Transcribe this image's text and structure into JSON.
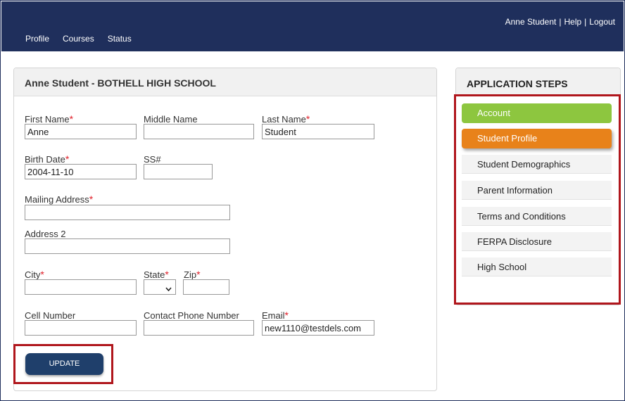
{
  "header": {
    "user_name": "Anne Student",
    "help": "Help",
    "logout": "Logout",
    "separator": "|"
  },
  "nav": {
    "items": [
      {
        "label": "Profile"
      },
      {
        "label": "Courses"
      },
      {
        "label": "Status"
      }
    ]
  },
  "form": {
    "title": "Anne Student - BOTHELL HIGH SCHOOL",
    "required_mark": "*",
    "first_name": {
      "label": "First Name",
      "value": "Anne"
    },
    "middle_name": {
      "label": "Middle Name",
      "value": ""
    },
    "last_name": {
      "label": "Last Name",
      "value": "Student"
    },
    "birth_date": {
      "label": "Birth Date",
      "value": "2004-11-10"
    },
    "ssn": {
      "label": "SS#",
      "value": ""
    },
    "mailing_address": {
      "label": "Mailing Address",
      "value": ""
    },
    "address2": {
      "label": "Address 2",
      "value": ""
    },
    "city": {
      "label": "City",
      "value": ""
    },
    "state": {
      "label": "State",
      "value": ""
    },
    "zip": {
      "label": "Zip",
      "value": ""
    },
    "cell_number": {
      "label": "Cell Number",
      "value": ""
    },
    "contact_phone": {
      "label": "Contact Phone Number",
      "value": ""
    },
    "email": {
      "label": "Email",
      "value": "new1110@testdels.com"
    },
    "update_label": "UPDATE"
  },
  "steps": {
    "title": "APPLICATION STEPS",
    "items": [
      {
        "label": "Account",
        "status": "complete"
      },
      {
        "label": "Student Profile",
        "status": "current"
      },
      {
        "label": "Student Demographics",
        "status": "pending"
      },
      {
        "label": "Parent Information",
        "status": "pending"
      },
      {
        "label": "Terms and Conditions",
        "status": "pending"
      },
      {
        "label": "FERPA Disclosure",
        "status": "pending"
      },
      {
        "label": "High School",
        "status": "pending"
      }
    ]
  },
  "colors": {
    "header_bg": "#1f2f5c",
    "step_complete": "#8dc63f",
    "step_current": "#e8821a",
    "highlight": "#b0161c",
    "button": "#1f3f6b"
  }
}
